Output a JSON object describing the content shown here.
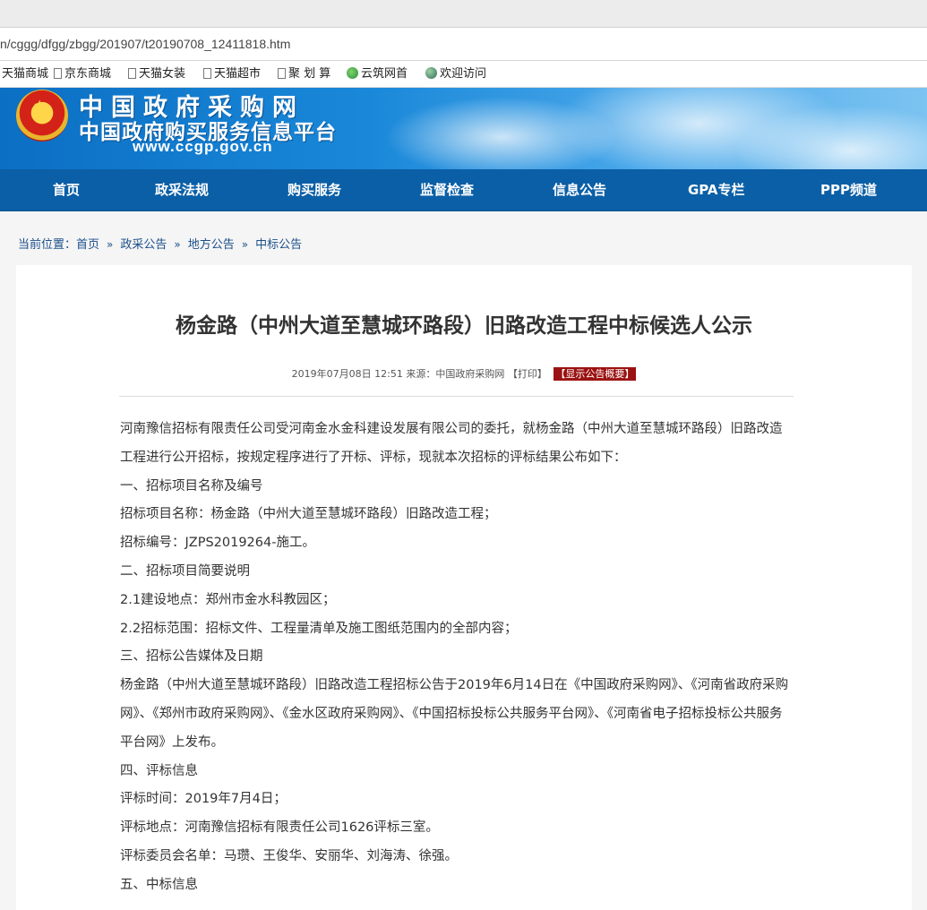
{
  "browser": {
    "url": "n/cggg/dfgg/zbgg/201907/t20190708_12411818.htm",
    "bookmarks": [
      {
        "label": "天猫商城",
        "icon": "page-icon"
      },
      {
        "label": "京东商城",
        "icon": "page-icon"
      },
      {
        "label": "天猫女装",
        "icon": "page-icon"
      },
      {
        "label": "天猫超市",
        "icon": "page-icon"
      },
      {
        "label": "聚 划 算",
        "icon": "page-icon"
      },
      {
        "label": "云筑网首",
        "icon": "yunzhu-icon"
      },
      {
        "label": "欢迎访问",
        "icon": "globe-icon"
      }
    ]
  },
  "site": {
    "name": "中国政府采购网",
    "subtitle": "中国政府购买服务信息平台",
    "url": "www.ccgp.gov.cn"
  },
  "nav": [
    "首页",
    "政采法规",
    "购买服务",
    "监督检查",
    "信息公告",
    "GPA专栏",
    "PPP频道"
  ],
  "breadcrumb": {
    "label": "当前位置：",
    "items": [
      "首页",
      "政采公告",
      "地方公告",
      "中标公告"
    ],
    "separator": "»"
  },
  "article": {
    "title": "杨金路（中州大道至慧城环路段）旧路改造工程中标候选人公示",
    "date": "2019年07月08日 12:51",
    "source": "来源：中国政府采购网",
    "print": "【打印】",
    "show_summary": "【显示公告概要】",
    "paragraphs": [
      "河南豫信招标有限责任公司受河南金水金科建设发展有限公司的委托，就杨金路（中州大道至慧城环路段）旧路改造工程进行公开招标，按规定程序进行了开标、评标，现就本次招标的评标结果公布如下：",
      "一、招标项目名称及编号",
      "招标项目名称：杨金路（中州大道至慧城环路段）旧路改造工程；",
      "招标编号：JZPS2019264-施工。",
      "二、招标项目简要说明",
      "2.1建设地点：郑州市金水科教园区；",
      "2.2招标范围：招标文件、工程量清单及施工图纸范围内的全部内容；",
      "三、招标公告媒体及日期",
      "杨金路（中州大道至慧城环路段）旧路改造工程招标公告于2019年6月14日在《中国政府采购网》、《河南省政府采购网》、《郑州市政府采购网》、《金水区政府采购网》、《中国招标投标公共服务平台网》、《河南省电子招标投标公共服务平台网》上发布。",
      "四、评标信息",
      "评标时间：2019年7月4日；",
      "评标地点：河南豫信招标有限责任公司1626评标三室。",
      "评标委员会名单：马瓒、王俊华、安丽华、刘海涛、徐强。",
      "五、中标信息"
    ]
  }
}
